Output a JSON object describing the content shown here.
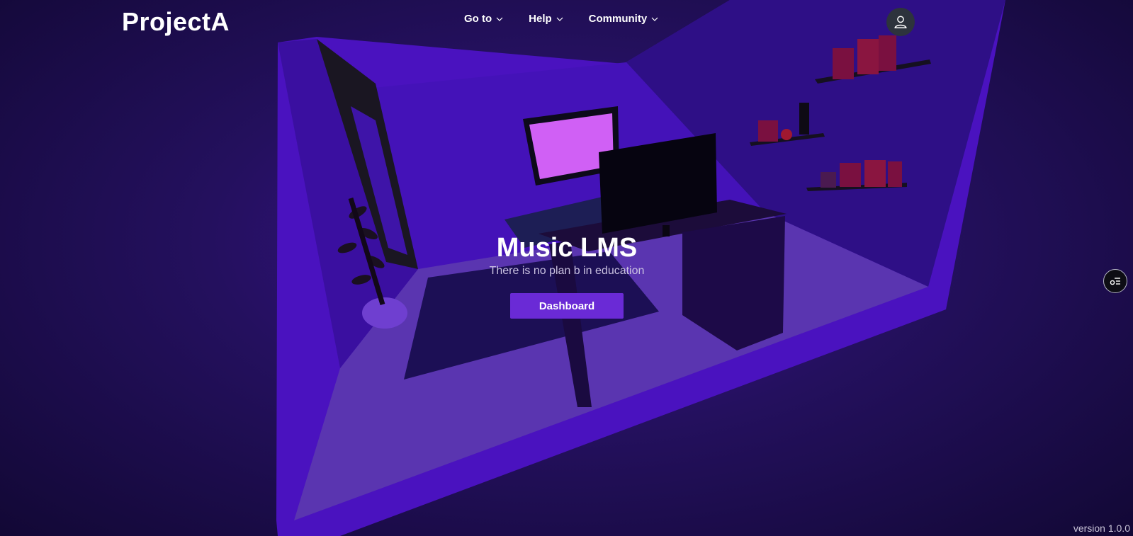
{
  "brand": {
    "name": "ProjectA"
  },
  "nav": {
    "items": [
      {
        "label": "Go to",
        "icon": "chevron-down-icon"
      },
      {
        "label": "Help",
        "icon": "chevron-down-icon"
      },
      {
        "label": "Community",
        "icon": "chevron-down-icon"
      }
    ]
  },
  "user": {
    "icon": "user-icon"
  },
  "hero": {
    "title": "Music LMS",
    "subtitle": "There is no plan b in education",
    "cta_label": "Dashboard"
  },
  "side_button": {
    "icon": "settings-list-icon"
  },
  "footer": {
    "version": "version 1.0.0"
  },
  "colors": {
    "accent": "#6a2ad6",
    "room_wall": "#4710b8",
    "room_floor": "#5a35b0",
    "monitor_screen": "#d060f5",
    "background": "#24105e"
  }
}
